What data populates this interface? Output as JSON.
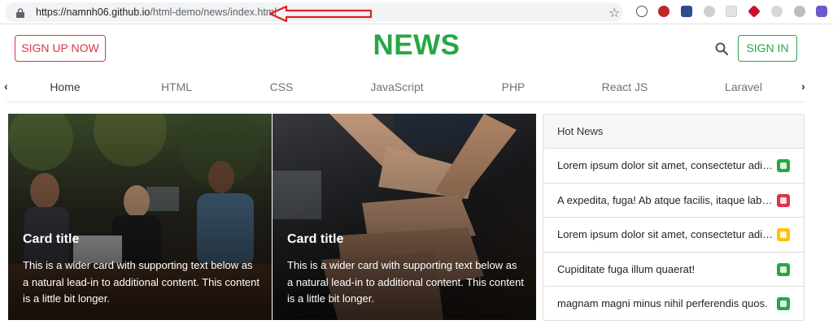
{
  "browser": {
    "url_host": "https://namnh06.github.io",
    "url_path": "/html-demo/news/index.html"
  },
  "header": {
    "signup_label": "SIGN UP NOW",
    "brand": "NEWS",
    "signin_label": "SIGN IN"
  },
  "nav": {
    "items": [
      "Home",
      "HTML",
      "CSS",
      "JavaScript",
      "PHP",
      "React JS",
      "Laravel"
    ],
    "prev_glyph": "‹",
    "next_glyph": "›"
  },
  "cards": [
    {
      "title": "Card title",
      "text": "This is a wider card with supporting text below as a natural lead-in to additional content. This content is a little bit longer."
    },
    {
      "title": "Card title",
      "text": "This is a wider card with supporting text below as a natural lead-in to additional content. This content is a little bit longer."
    }
  ],
  "hot_news": {
    "heading": "Hot News",
    "items": [
      {
        "text": "Lorem ipsum dolor sit amet, consectetur adipisicing elit.",
        "badge_color": "#28a745"
      },
      {
        "text": "A expedita, fuga! Ab atque facilis, itaque laborum.",
        "badge_color": "#dc3545"
      },
      {
        "text": "Lorem ipsum dolor sit amet, consectetur adipisicing elit.",
        "badge_color": "#ffc107"
      },
      {
        "text": "Cupiditate fuga illum quaerat!",
        "badge_color": "#28a745"
      },
      {
        "text": "magnam magni minus nihil perferendis quos.",
        "badge_color": "#28a745"
      }
    ]
  },
  "colors": {
    "brand_green": "#28a745",
    "danger_red": "#dc3545",
    "annotation_arrow": "#e02020"
  }
}
